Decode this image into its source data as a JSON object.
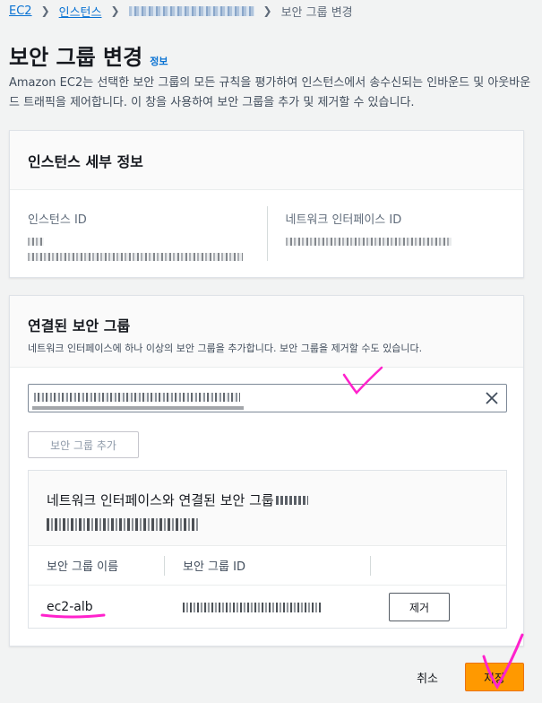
{
  "breadcrumb": {
    "items": [
      "EC2",
      "인스턴스"
    ],
    "current": "보안 그룹 변경"
  },
  "page": {
    "title": "보안 그룹 변경",
    "info_link": "정보",
    "description": "Amazon EC2는 선택한 보안 그룹의 모든 규칙을 평가하여 인스턴스에서 송수신되는 인바운드 및 아웃바운드 트래픽을 제어합니다. 이 창을 사용하여 보안 그룹을 추가 및 제거할 수 있습니다."
  },
  "instance_details": {
    "title": "인스턴스 세부 정보",
    "instance_id_label": "인스턴스 ID",
    "network_interface_id_label": "네트워크 인터페이스 ID"
  },
  "associated_groups": {
    "title": "연결된 보안 그룹",
    "subtitle": "네트워크 인터페이스에 하나 이상의 보안 그룹을 추가합니다. 보안 그룹을 제거할 수도 있습니다.",
    "add_button": "보안 그룹 추가",
    "inner_title": "네트워크 인터페이스와 연결된 보안 그룹",
    "columns": {
      "name": "보안 그룹 이름",
      "id": "보안 그룹 ID"
    },
    "rows": [
      {
        "name": "ec2-alb",
        "remove_label": "제거"
      }
    ]
  },
  "footer": {
    "cancel": "취소",
    "save": "저장"
  },
  "icons": {
    "clear": "close-icon",
    "separator": "chevron-right-icon"
  },
  "colors": {
    "accent": "#ff9900",
    "link": "#0972d3",
    "annotation": "#ff00cc"
  }
}
